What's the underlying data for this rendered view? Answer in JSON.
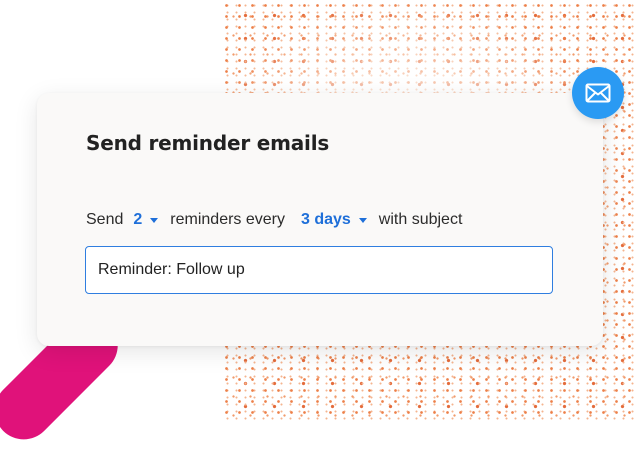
{
  "card": {
    "title": "Send reminder emails"
  },
  "sentence": {
    "prefix": "Send",
    "count_value": "2",
    "middle": "reminders every",
    "interval_value": "3 days",
    "suffix": "with subject"
  },
  "subject_input": {
    "value": "Reminder: Follow up"
  },
  "icons": {
    "badge": "mail-icon",
    "dropdown_caret": "caret-down-icon"
  },
  "colors": {
    "accent_blue": "#1e6fd9",
    "badge_blue": "#2a9af3",
    "pink": "#e0127a",
    "speckle_orange": "#ea6a2a"
  }
}
